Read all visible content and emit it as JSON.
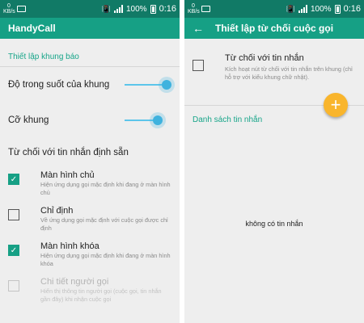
{
  "status": {
    "kbs_top": "0",
    "kbs_bottom": "KB/s",
    "battery": "100%",
    "time": "0:16"
  },
  "left": {
    "app_title": "HandyCall",
    "section_title": "Thiết lập khung báo",
    "transparency_label": "Độ trong suốt của khung",
    "transparency_level": 1.0,
    "frame_size_label": "Cỡ khung",
    "frame_size_level": 0.75,
    "reject_label": "Từ chối với tin nhắn định sẵn",
    "items": [
      {
        "title": "Màn hình chủ",
        "desc": "Hiện ứng dụng gọi mặc định khi đang ở màn hình chủ",
        "checked": true,
        "disabled": false
      },
      {
        "title": "Chỉ định",
        "desc": "Về ứng dụng gọi mặc định với cuộc gọi được chỉ định",
        "checked": false,
        "disabled": false
      },
      {
        "title": "Màn hình khóa",
        "desc": "Hiện ứng dụng gọi mặc định khi đang ở màn hình khóa",
        "checked": true,
        "disabled": false
      },
      {
        "title": "Chi tiết người gọi",
        "desc": "Hiển thị thông tin người gọi (cuộc gọi, tin nhắn gần đây) khi nhận cuộc gọi",
        "checked": false,
        "disabled": true
      }
    ]
  },
  "right": {
    "title": "Thiết lập từ chối cuộc gọi",
    "option_title": "Từ chối với tin nhắn",
    "option_desc": "Kích hoạt nút từ chối với tin nhắn trên khung (chỉ hỗ trợ với kiểu khung chữ nhật).",
    "option_checked": false,
    "list_header": "Danh sách tin nhắn",
    "empty_text": "không có tin nhắn",
    "fab_label": "+"
  },
  "colors": {
    "statusbar": "#117a66",
    "appbar": "#16a085",
    "accent": "#17a589",
    "slider": "#3fb2de",
    "fab": "#f9b52c"
  }
}
